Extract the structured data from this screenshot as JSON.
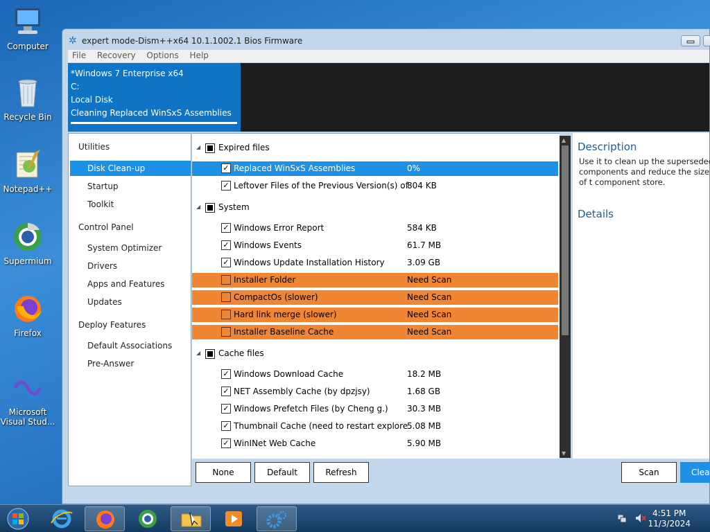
{
  "desktop": {
    "icons": [
      {
        "label": "Computer",
        "icon": "computer-icon"
      },
      {
        "label": "Recycle Bin",
        "icon": "recycle-bin-icon"
      },
      {
        "label": "Notepad++",
        "icon": "notepadpp-icon"
      },
      {
        "label": "Supermium",
        "icon": "supermium-icon"
      },
      {
        "label": "Firefox",
        "icon": "firefox-icon"
      },
      {
        "label": "Microsoft Visual Stud...",
        "icon": "visual-studio-icon"
      }
    ]
  },
  "window": {
    "title": "expert mode-Dism++x64 10.1.1002.1 Bios Firmware",
    "menu": [
      "File",
      "Recovery",
      "Options",
      "Help"
    ],
    "info": [
      "*Windows 7 Enterprise x64",
      "C:",
      "Local Disk",
      "Cleaning Replaced WinSxS Assemblies"
    ]
  },
  "nav": {
    "utilities": "Utilities",
    "disk_cleanup": "Disk Clean-up",
    "startup": "Startup",
    "toolkit": "Toolkit",
    "control_panel": "Control Panel",
    "system_optimizer": "System Optimizer",
    "drivers": "Drivers",
    "apps_features": "Apps and Features",
    "updates": "Updates",
    "deploy_features": "Deploy Features",
    "default_assoc": "Default Associations",
    "pre_answer": "Pre-Answer"
  },
  "groups": {
    "expired": "Expired files",
    "system": "System",
    "cache": "Cache files"
  },
  "rows": [
    {
      "name": "Replaced WinSxS Assemblies",
      "size": "0%",
      "checked": true,
      "state": "selected"
    },
    {
      "name": "Leftover Files of the Previous Version(s) of Dism++",
      "size": "804 KB",
      "checked": true,
      "state": "normal"
    },
    {
      "name": "Windows Error Report",
      "size": "584 KB",
      "checked": true,
      "state": "normal"
    },
    {
      "name": "Windows Events",
      "size": "61.7 MB",
      "checked": true,
      "state": "normal"
    },
    {
      "name": "Windows Update Installation History",
      "size": "3.09 GB",
      "checked": true,
      "state": "normal"
    },
    {
      "name": "Installer Folder",
      "size": "Need Scan",
      "checked": false,
      "state": "warn"
    },
    {
      "name": "CompactOs (slower)",
      "size": "Need Scan",
      "checked": false,
      "state": "warn"
    },
    {
      "name": "Hard link merge (slower)",
      "size": "Need Scan",
      "checked": false,
      "state": "warn"
    },
    {
      "name": "Installer Baseline Cache",
      "size": "Need Scan",
      "checked": false,
      "state": "warn"
    },
    {
      "name": "Windows Download Cache",
      "size": "18.2 MB",
      "checked": true,
      "state": "normal"
    },
    {
      "name": "NET Assembly Cache (by dpzjsy)",
      "size": "1.68 GB",
      "checked": true,
      "state": "normal"
    },
    {
      "name": "Windows Prefetch Files (by Cheng g.)",
      "size": "30.3 MB",
      "checked": true,
      "state": "normal"
    },
    {
      "name": "Thumbnail Cache (need to restart explorer)",
      "size": "5.08 MB",
      "checked": true,
      "state": "normal"
    },
    {
      "name": "WinINet Web Cache",
      "size": "5.90 MB",
      "checked": true,
      "state": "normal"
    }
  ],
  "description": {
    "title": "Description",
    "text": "Use it to clean up the superseded components and reduce the size of t component store.",
    "details": "Details"
  },
  "buttons": {
    "none": "None",
    "default": "Default",
    "refresh": "Refresh",
    "scan": "Scan",
    "clean": "Clean"
  },
  "taskbar": {
    "time": "4:51 PM",
    "date": "11/3/2024"
  },
  "colors": {
    "selection": "#1e90e6",
    "warn_row": "#f08634",
    "info_panel": "#0f74c6"
  }
}
